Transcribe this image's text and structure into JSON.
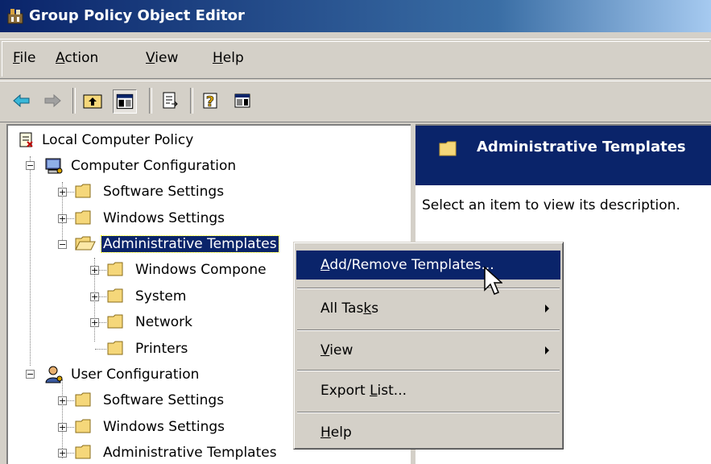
{
  "window": {
    "title": "Group Policy Object Editor"
  },
  "menubar": {
    "items": [
      {
        "pre": "",
        "u": "F",
        "post": "ile"
      },
      {
        "pre": "",
        "u": "A",
        "post": "ction"
      },
      {
        "pre": "",
        "u": "V",
        "post": "iew"
      },
      {
        "pre": "",
        "u": "H",
        "post": "elp"
      }
    ]
  },
  "tree": {
    "root": "Local Computer Policy",
    "computer_config": "Computer Configuration",
    "cc_software": "Software Settings",
    "cc_windows": "Windows Settings",
    "cc_admin": "Administrative Templates",
    "admin_windows_components": "Windows Compone",
    "admin_system": "System",
    "admin_network": "Network",
    "admin_printers": "Printers",
    "user_config": "User Configuration",
    "uc_software": "Software Settings",
    "uc_windows": "Windows Settings",
    "uc_admin": "Administrative Templates"
  },
  "right_pane": {
    "header": "Administrative Templates",
    "description": "Select an item to view its description."
  },
  "context_menu": {
    "add_remove": {
      "pre": "",
      "u": "A",
      "post": "dd/Remove Templates..."
    },
    "all_tasks": {
      "pre": "All Tas",
      "u": "k",
      "post": "s"
    },
    "view": {
      "pre": "",
      "u": "V",
      "post": "iew"
    },
    "export": {
      "pre": "Export ",
      "u": "L",
      "post": "ist..."
    },
    "help": {
      "pre": "",
      "u": "H",
      "post": "elp"
    }
  },
  "colors": {
    "selection": "#0a246a",
    "face": "#d4d0c8",
    "folder": "#f5d77a"
  }
}
